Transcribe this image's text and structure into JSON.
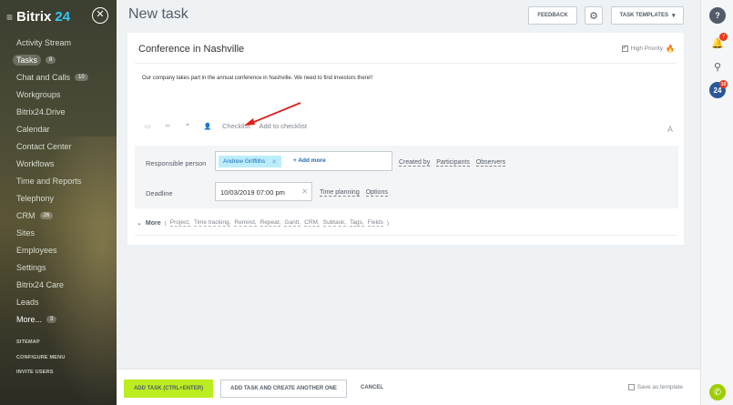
{
  "sidebar": {
    "logo": {
      "name": "Bitrix",
      "number": "24"
    },
    "items": [
      {
        "label": "Activity Stream",
        "count": ""
      },
      {
        "label": "Tasks",
        "count": "8",
        "active": true
      },
      {
        "label": "Chat and Calls",
        "count": "10"
      },
      {
        "label": "Workgroups",
        "count": ""
      },
      {
        "label": "Bitrix24.Drive",
        "count": ""
      },
      {
        "label": "Calendar",
        "count": ""
      },
      {
        "label": "Contact Center",
        "count": ""
      },
      {
        "label": "Workflows",
        "count": ""
      },
      {
        "label": "Time and Reports",
        "count": ""
      },
      {
        "label": "Telephony",
        "count": ""
      },
      {
        "label": "CRM",
        "count": "26"
      },
      {
        "label": "Sites",
        "count": ""
      },
      {
        "label": "Employees",
        "count": ""
      },
      {
        "label": "Settings",
        "count": ""
      },
      {
        "label": "Bitrix24 Care",
        "count": ""
      },
      {
        "label": "Leads",
        "count": ""
      },
      {
        "label": "More...",
        "count": "3"
      }
    ],
    "sitemap": "SITEMAP",
    "configure_menu": "CONFIGURE MENU",
    "invite_users": "INVITE USERS"
  },
  "header": {
    "title": "New task",
    "feedback": "FEEDBACK",
    "task_templates": "TASK TEMPLATES"
  },
  "task": {
    "title": "Conference in Nashville",
    "high_priority": "High Priority",
    "description": "Our company takes part in the annual conference in Nashville. We need to find investors there!!",
    "toolbar": {
      "checklist": "Checklist",
      "add_to_checklist": "Add to checklist",
      "font": "A"
    },
    "responsible_label": "Responsible person",
    "responsible_person": "Andrew Griffiths",
    "add_more": "+ Add more",
    "created_by": "Created by",
    "participants": "Participants",
    "observers": "Observers",
    "deadline_label": "Deadline",
    "deadline_value": "10/03/2019 07:00 pm",
    "time_planning": "Time planning",
    "options": "Options",
    "more": "More",
    "more_items": [
      "Project,",
      "Time tracking,",
      "Remind,",
      "Repeat,",
      "Gantt,",
      "CRM,",
      "Subtask,",
      "Tags,",
      "Fields"
    ]
  },
  "footer": {
    "add_task": "ADD TASK (CTRL+ENTER)",
    "add_and_create": "ADD TASK AND CREATE ANOTHER ONE",
    "cancel": "CANCEL",
    "save_as_template": "Save as template"
  },
  "right_panel": {
    "help": "?",
    "bell_badge": "7",
    "bitrix24": "24",
    "bitrix24_badge": "10"
  },
  "colors": {
    "accent_green": "#bbed21",
    "link_blue": "#2067b0",
    "chip_bg": "#bcedfc",
    "arrow_red": "#e0201b"
  }
}
